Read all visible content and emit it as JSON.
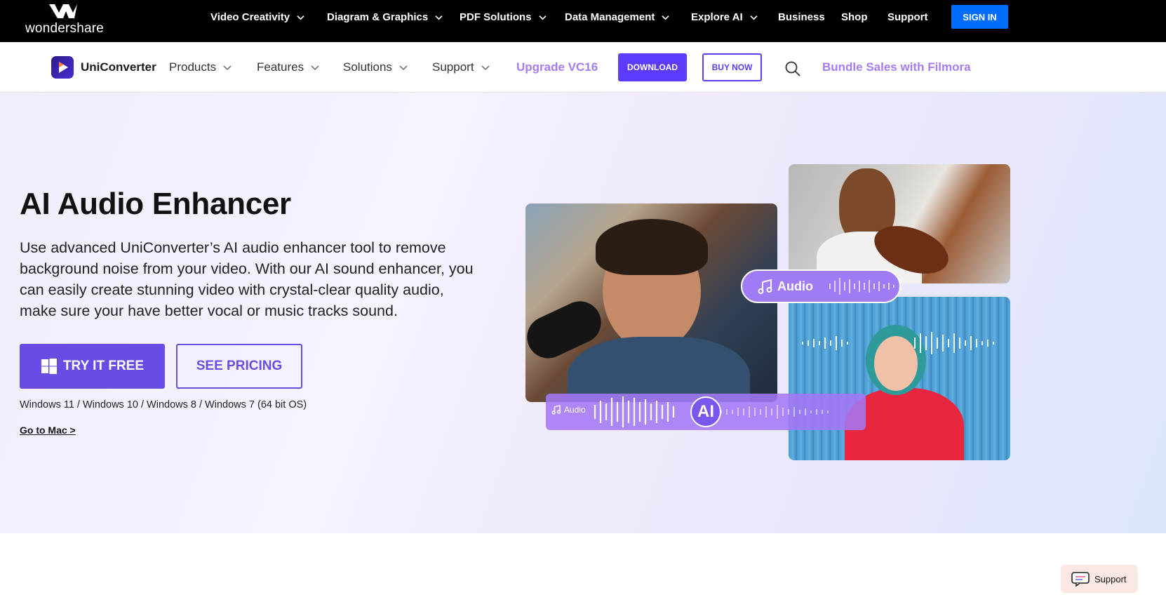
{
  "brand": {
    "name": "wondershare"
  },
  "topnav": {
    "items": [
      {
        "label": "Video Creativity",
        "has_dropdown": true
      },
      {
        "label": "Diagram & Graphics",
        "has_dropdown": true
      },
      {
        "label": "PDF Solutions",
        "has_dropdown": true
      },
      {
        "label": "Data Management",
        "has_dropdown": true
      },
      {
        "label": "Explore AI",
        "has_dropdown": true
      },
      {
        "label": "Business",
        "has_dropdown": false
      },
      {
        "label": "Shop",
        "has_dropdown": false
      },
      {
        "label": "Support",
        "has_dropdown": false
      }
    ],
    "signin_label": "SIGN IN"
  },
  "product_nav": {
    "product_name": "UniConverter",
    "items": [
      {
        "label": "Products"
      },
      {
        "label": "Features"
      },
      {
        "label": "Solutions"
      },
      {
        "label": "Support"
      }
    ],
    "upgrade_label": "Upgrade VC16",
    "download_label": "DOWNLOAD",
    "buy_label": "BUY NOW",
    "bundle_label": "Bundle Sales with Filmora"
  },
  "hero": {
    "title": "AI Audio Enhancer",
    "description": "Use advanced UniConverter’s AI audio enhancer tool to remove background noise from your video. With our AI sound enhancer, you can easily create stunning video with crystal-clear quality audio, make sure your have better vocal or music tracks sound.",
    "try_label": "TRY IT FREE",
    "pricing_label": "SEE PRICING",
    "os_note": "Windows 11 / Windows 10 / Windows 8 / Windows 7 (64 bit OS)",
    "mac_link": "Go to Mac >",
    "audio_pill_label": "Audio",
    "audio_bar_label": "Audio",
    "ai_badge": "AI"
  },
  "support_widget": {
    "label": "Support"
  },
  "colors": {
    "topbar_bg": "#000000",
    "signin_bg": "#006dff",
    "primary_purple": "#5c3bff",
    "accent_lavender": "#a67cf5",
    "hero_bg": "#f1eefb"
  }
}
